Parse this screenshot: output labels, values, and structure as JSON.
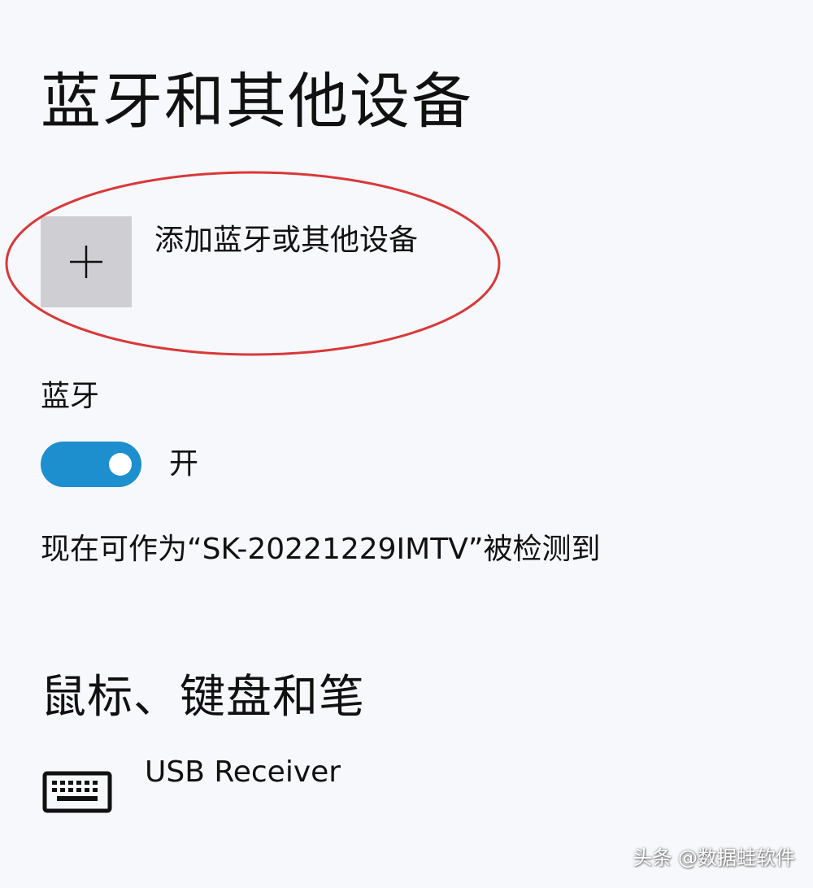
{
  "page": {
    "title": "蓝牙和其他设备"
  },
  "add_device": {
    "icon": "plus-icon",
    "label": "添加蓝牙或其他设备",
    "highlight_color": "#d9383a"
  },
  "bluetooth": {
    "label": "蓝牙",
    "toggle_on": true,
    "toggle_color": "#1d8fce",
    "state_text": "开",
    "discoverable_text": "现在可作为“SK-20221229IMTV”被检测到"
  },
  "mouse_keyboard_pen": {
    "title": "鼠标、键盘和笔",
    "devices": [
      {
        "icon": "keyboard-icon",
        "name": "USB Receiver"
      }
    ]
  },
  "watermark": {
    "text": "头条 @数据蛙软件"
  }
}
